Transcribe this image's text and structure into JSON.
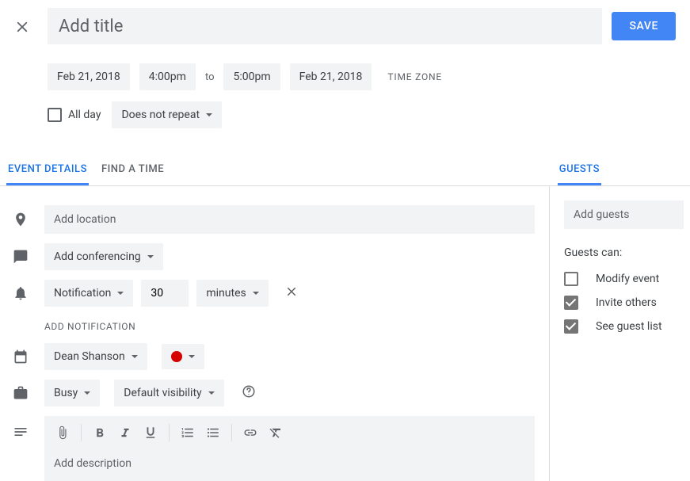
{
  "title": {
    "placeholder": "Add title",
    "value": ""
  },
  "save_label": "SAVE",
  "when": {
    "start_date": "Feb 21, 2018",
    "start_time": "4:00pm",
    "to": "to",
    "end_time": "5:00pm",
    "end_date": "Feb 21, 2018",
    "timezone_label": "TIME ZONE"
  },
  "allday_label": "All day",
  "recurrence": "Does not repeat",
  "tabs": {
    "event_details": "EVENT DETAILS",
    "find_a_time": "FIND A TIME",
    "guests": "GUESTS"
  },
  "location_placeholder": "Add location",
  "conferencing_label": "Add conferencing",
  "notification": {
    "type": "Notification",
    "value": "30",
    "unit": "minutes"
  },
  "add_notification_label": "ADD NOTIFICATION",
  "calendar_owner": "Dean Shanson",
  "event_color": "#d50000",
  "availability": "Busy",
  "visibility": "Default visibility",
  "description_placeholder": "Add description",
  "guests_placeholder": "Add guests",
  "guests_can_label": "Guests can:",
  "permissions": {
    "modify": {
      "label": "Modify event",
      "checked": false
    },
    "invite": {
      "label": "Invite others",
      "checked": true
    },
    "see": {
      "label": "See guest list",
      "checked": true
    }
  }
}
